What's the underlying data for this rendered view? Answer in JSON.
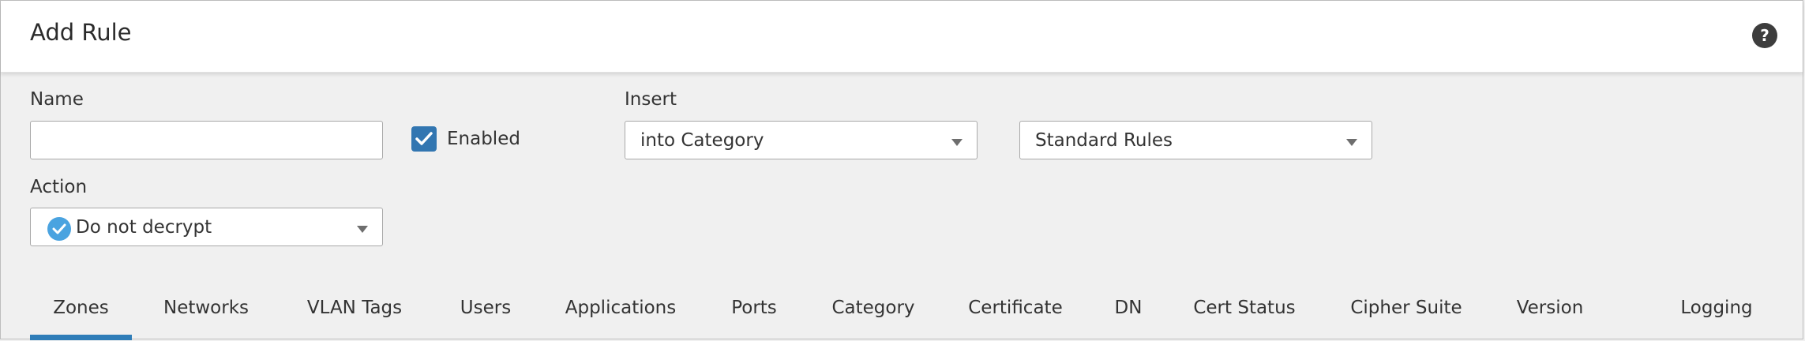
{
  "dialog": {
    "title": "Add Rule",
    "help_icon": "?"
  },
  "form": {
    "name_label": "Name",
    "name_value": "",
    "enabled_label": "Enabled",
    "enabled_checked": true,
    "insert_label": "Insert",
    "insert_position": "into Category",
    "insert_category": "Standard Rules",
    "action_label": "Action",
    "action_value": "Do not decrypt"
  },
  "tabs": [
    {
      "label": "Zones",
      "active": true
    },
    {
      "label": "Networks"
    },
    {
      "label": "VLAN Tags"
    },
    {
      "label": "Users"
    },
    {
      "label": "Applications"
    },
    {
      "label": "Ports"
    },
    {
      "label": "Category"
    },
    {
      "label": "Certificate"
    },
    {
      "label": "DN"
    },
    {
      "label": "Cert Status"
    },
    {
      "label": "Cipher Suite"
    },
    {
      "label": "Version"
    },
    {
      "label": "Logging"
    }
  ],
  "colors": {
    "accent": "#2f7db8",
    "checkbox": "#3276b1",
    "action_icon": "#4aa3e0",
    "background": "#f0f0f0"
  }
}
